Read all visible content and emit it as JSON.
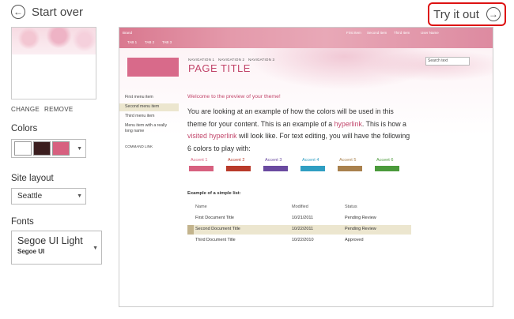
{
  "header": {
    "start_over": "Start over",
    "try_it_out": "Try it out"
  },
  "left": {
    "change": "CHANGE",
    "remove": "REMOVE",
    "colors_label": "Colors",
    "swatches": [
      "#ffffff",
      "#3b1e1f",
      "#d7607f"
    ],
    "site_layout_label": "Site layout",
    "site_layout_value": "Seattle",
    "fonts_label": "Fonts",
    "font_heading": "Segoe UI Light",
    "font_body": "Segoe UI"
  },
  "preview": {
    "brand": "Brand",
    "top_links": [
      "First Item",
      "Second Item",
      "Third Item",
      "User Name"
    ],
    "tabs": [
      "TAB 1",
      "TAB 2",
      "TAB 3"
    ],
    "nav": [
      "NAVIGATION 1",
      "NAVIGATION 2",
      "NAVIGATION 3"
    ],
    "page_title": "PAGE TITLE",
    "search_placeholder": "Search text",
    "left_nav": [
      "First menu item",
      "Second menu item",
      "Third menu item",
      "Menu item with a really long name",
      "COMMAND LINK"
    ],
    "welcome": "Welcome to the preview of your theme!",
    "body_1": "You are looking at an example of how the colors will be used in this theme for your content. This is an example of a ",
    "hyperlink": "hyperlink",
    "body_2": ". This is how a ",
    "visited_hyperlink": "visited hyperlink",
    "body_3": " will look like. For text editing, you will have the following 6 colors to play with:",
    "accents": [
      {
        "label": "Accent 1",
        "color": "#d7607f"
      },
      {
        "label": "Accent 2",
        "color": "#b93a2a"
      },
      {
        "label": "Accent 3",
        "color": "#6a4aa0"
      },
      {
        "label": "Accent 4",
        "color": "#2f9ec2"
      },
      {
        "label": "Accent 5",
        "color": "#a9814d"
      },
      {
        "label": "Accent 6",
        "color": "#4b9a3b"
      }
    ],
    "list_title": "Example of a simple list:",
    "list_headers": [
      "Name",
      "Modified",
      "Status"
    ],
    "list_rows": [
      [
        "First Document Title",
        "10/21/2011",
        "Pending Review"
      ],
      [
        "Second Document Title",
        "10/22/2011",
        "Pending Review"
      ],
      [
        "Third Document Title",
        "10/22/2010",
        "Approved"
      ]
    ]
  }
}
